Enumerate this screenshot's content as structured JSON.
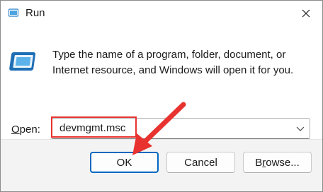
{
  "window": {
    "title": "Run"
  },
  "description": {
    "line1": "Type the name of a program, folder, document, or",
    "line2": "Internet resource, and Windows will open it for you."
  },
  "open_field": {
    "label_underlined": "O",
    "label_rest": "pen:",
    "value": "devmgmt.msc"
  },
  "buttons": {
    "ok": "OK",
    "cancel": "Cancel",
    "browse_prefix": "B",
    "browse_underlined": "r",
    "browse_rest": "owse..."
  },
  "icons": {
    "title": "run-app-icon",
    "close": "close-icon",
    "run": "run-program-icon",
    "dropdown": "chevron-down-icon"
  },
  "colors": {
    "annotation": "#e8322f",
    "ok_focus": "#0067c0"
  }
}
